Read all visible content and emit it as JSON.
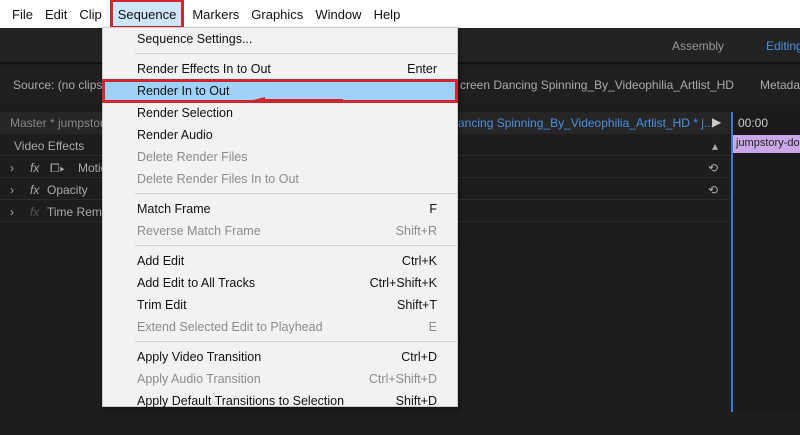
{
  "menubar": [
    "File",
    "Edit",
    "Clip",
    "Sequence",
    "Markers",
    "Graphics",
    "Window",
    "Help"
  ],
  "workspaces": {
    "assembly": "Assembly",
    "editing": "Editing"
  },
  "source": {
    "label": "Source: (no clips)",
    "clip_tab": "creen Dancing Spinning_By_Videophilia_Artlist_HD",
    "metadata": "Metadat"
  },
  "master": {
    "label": "Master * jumpstor",
    "sequence": "ancing Spinning_By_Videophilia_Artlist_HD * j...",
    "timecode": "00:00"
  },
  "effects": {
    "header": "Video Effects",
    "items": [
      "Motio",
      "Opacity",
      "Time Rema"
    ]
  },
  "clip": "jumpstory-do",
  "menu": {
    "groups": [
      [
        {
          "label": "Sequence Settings...",
          "shortcut": "",
          "disabled": false
        }
      ],
      [
        {
          "label": "Render Effects In to Out",
          "shortcut": "Enter",
          "disabled": false
        },
        {
          "label": "Render In to Out",
          "shortcut": "",
          "disabled": false,
          "highlighted": true
        },
        {
          "label": "Render Selection",
          "shortcut": "",
          "disabled": false
        },
        {
          "label": "Render Audio",
          "shortcut": "",
          "disabled": false
        },
        {
          "label": "Delete Render Files",
          "shortcut": "",
          "disabled": true
        },
        {
          "label": "Delete Render Files In to Out",
          "shortcut": "",
          "disabled": true
        }
      ],
      [
        {
          "label": "Match Frame",
          "shortcut": "F",
          "disabled": false
        },
        {
          "label": "Reverse Match Frame",
          "shortcut": "Shift+R",
          "disabled": true
        }
      ],
      [
        {
          "label": "Add Edit",
          "shortcut": "Ctrl+K",
          "disabled": false
        },
        {
          "label": "Add Edit to All Tracks",
          "shortcut": "Ctrl+Shift+K",
          "disabled": false
        },
        {
          "label": "Trim Edit",
          "shortcut": "Shift+T",
          "disabled": false
        },
        {
          "label": "Extend Selected Edit to Playhead",
          "shortcut": "E",
          "disabled": true
        }
      ],
      [
        {
          "label": "Apply Video Transition",
          "shortcut": "Ctrl+D",
          "disabled": false
        },
        {
          "label": "Apply Audio Transition",
          "shortcut": "Ctrl+Shift+D",
          "disabled": true
        },
        {
          "label": "Apply Default Transitions to Selection",
          "shortcut": "Shift+D",
          "disabled": false
        }
      ]
    ]
  }
}
